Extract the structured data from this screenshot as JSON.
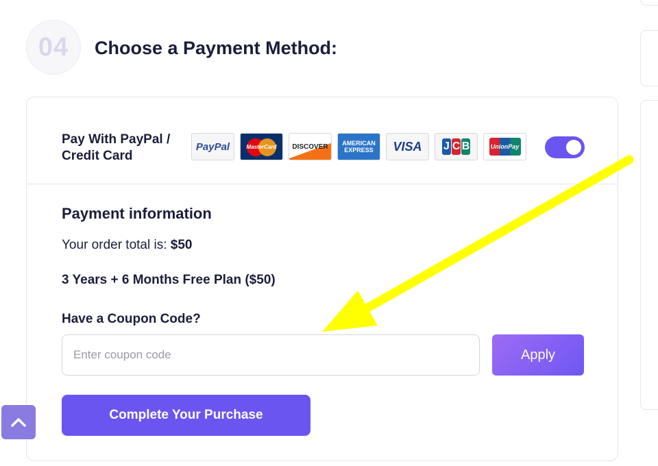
{
  "step": {
    "number": "04",
    "title": "Choose a Payment Method:"
  },
  "payment_option": {
    "label": "Pay With PayPal / Credit Card",
    "logos": [
      {
        "name": "paypal-logo",
        "text": "PayPal"
      },
      {
        "name": "mastercard-logo",
        "text": "MasterCard"
      },
      {
        "name": "discover-logo",
        "text": "DISCOVER"
      },
      {
        "name": "amex-logo",
        "text": "AMERICAN EXPRESS"
      },
      {
        "name": "visa-logo",
        "text": "VISA"
      },
      {
        "name": "jcb-logo",
        "text": "JCB"
      },
      {
        "name": "unionpay-logo",
        "text": "UnionPay"
      }
    ],
    "toggle_on": true
  },
  "payment_info": {
    "title": "Payment information",
    "order_total_label": "Your order total is:",
    "order_total_value": "$50",
    "plan": "3 Years + 6 Months Free Plan ($50)",
    "coupon_question": "Have a Coupon Code?",
    "coupon_placeholder": "Enter coupon code",
    "apply_label": "Apply",
    "purchase_label": "Complete Your Purchase"
  },
  "colors": {
    "accent": "#6b55f0",
    "annotation_arrow": "#ffff00",
    "title_text": "#1b1d3a"
  },
  "icons": {
    "scroll_top": "chevron-up-icon",
    "annotation": "arrow-icon"
  }
}
